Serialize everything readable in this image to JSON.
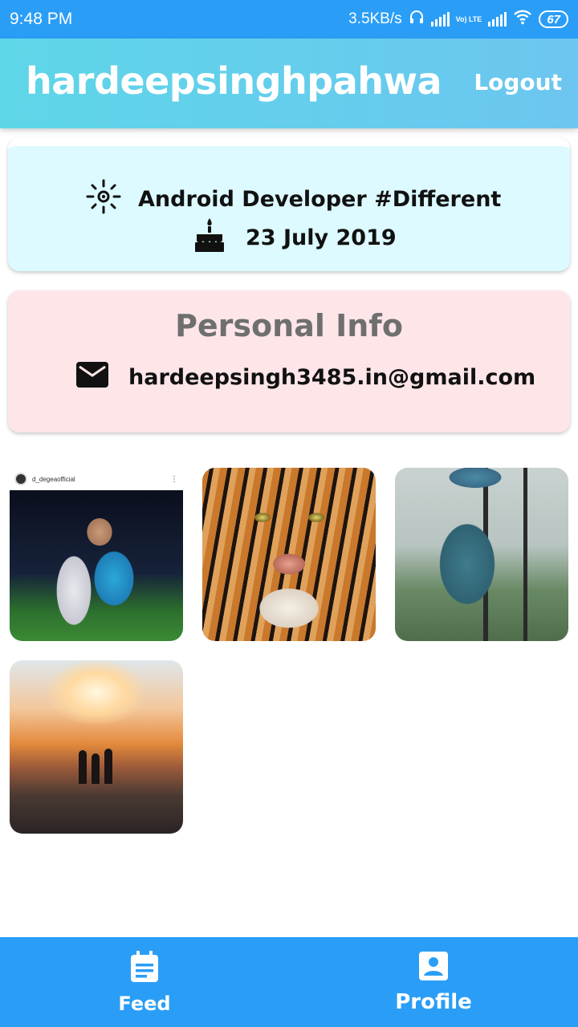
{
  "status_bar": {
    "time": "9:48 PM",
    "net_speed": "3.5KB/s",
    "volte_label": "Vo) LTE",
    "battery": "67"
  },
  "app_bar": {
    "title": "hardeepsinghpahwa",
    "logout_label": "Logout"
  },
  "about_card": {
    "bio": "Android Developer  #Different",
    "joined_date": "23 July 2019"
  },
  "info_card": {
    "title": "Personal Info",
    "email": "hardeepsingh3485.in@gmail.com"
  },
  "posts": [
    {
      "kind": "photo",
      "caption_header": "d_degeaofficial",
      "description": "football goalkeeper"
    },
    {
      "kind": "photo",
      "description": "tiger face"
    },
    {
      "kind": "photo",
      "description": "man near window"
    },
    {
      "kind": "photo",
      "description": "sunset silhouettes"
    }
  ],
  "bottom_nav": {
    "items": [
      {
        "label": "Feed",
        "icon": "feed-icon"
      },
      {
        "label": "Profile",
        "icon": "profile-icon"
      }
    ]
  },
  "colors": {
    "status_bar": "#2a9ef7",
    "app_bar_start": "#5dd6e8",
    "app_bar_end": "#6cc6f0",
    "about_card_bg": "#dcfaff",
    "info_card_bg": "#fde5e8",
    "bottom_nav": "#2a9ef7"
  }
}
